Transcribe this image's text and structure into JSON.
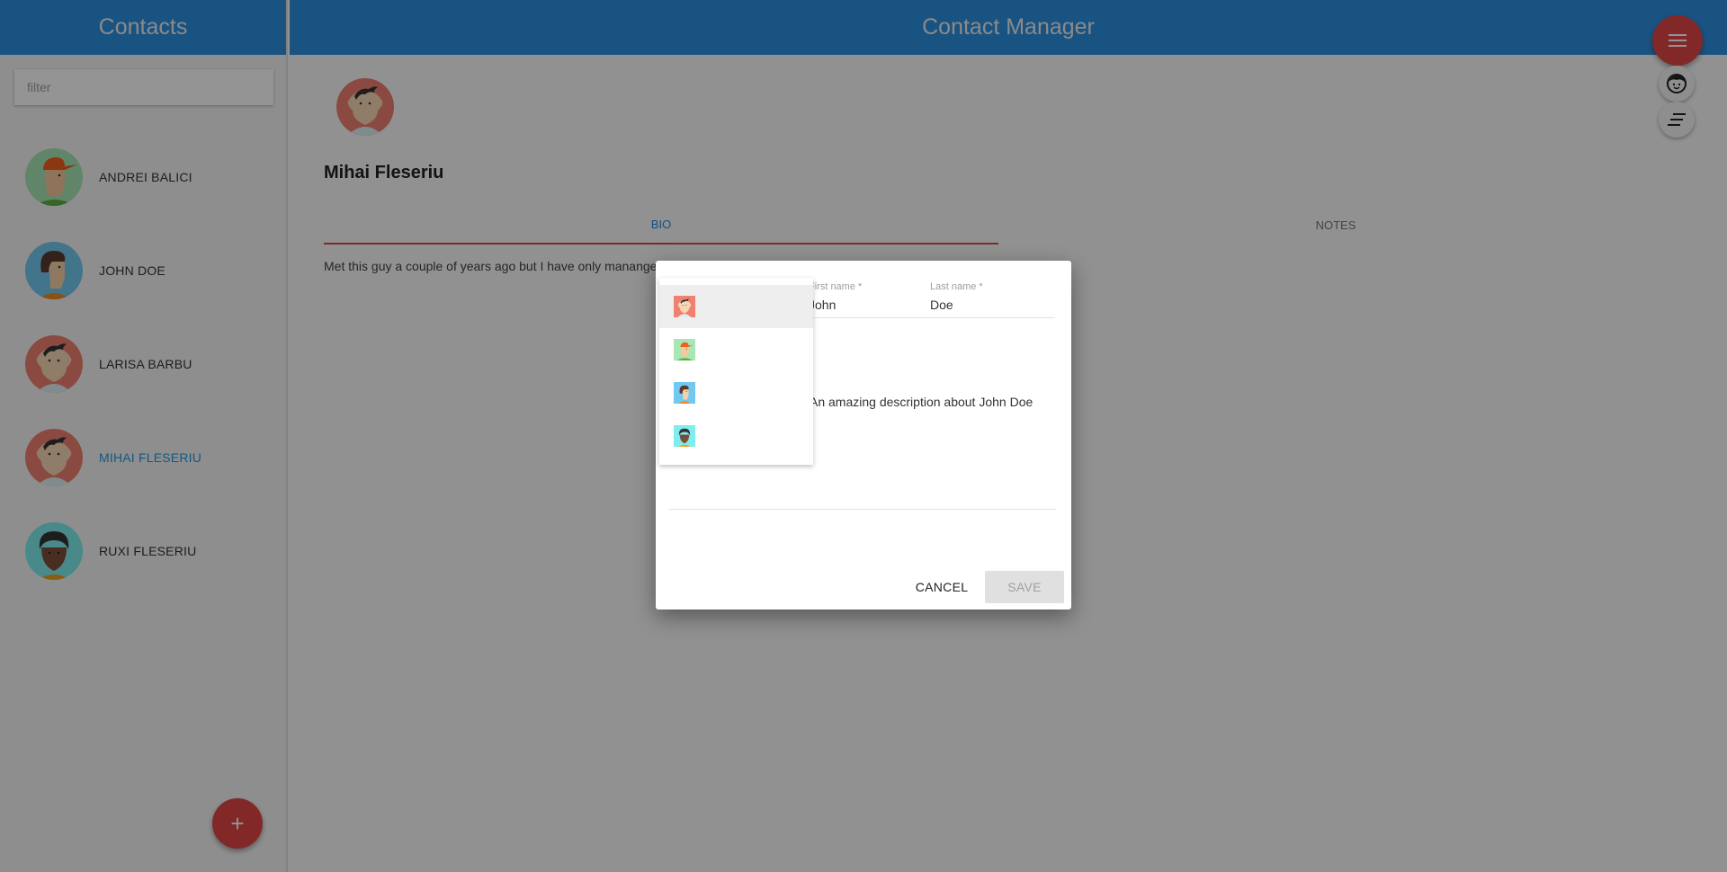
{
  "sidebar": {
    "title": "Contacts",
    "filter_placeholder": "filter",
    "filter_value": "",
    "contacts": [
      {
        "name": "ANDREI BALICI",
        "avatar": "avatar-cap-green",
        "selected": false
      },
      {
        "name": "JOHN DOE",
        "avatar": "avatar-hair-blue",
        "selected": false
      },
      {
        "name": "LARISA BARBU",
        "avatar": "avatar-boy-red",
        "selected": false
      },
      {
        "name": "MIHAI FLESERIU",
        "avatar": "avatar-boy-red",
        "selected": true
      },
      {
        "name": "RUXI FLESERIU",
        "avatar": "avatar-dark-teal",
        "selected": false
      }
    ],
    "add_button_icon": "+"
  },
  "main": {
    "title": "Contact Manager",
    "selected_name": "Mihai Fleseriu",
    "tabs": [
      {
        "label": "BIO",
        "active": true
      },
      {
        "label": "NOTES",
        "active": false
      }
    ],
    "bio_text": "Met this guy a couple of years ago but I have only mananged to make one good friend."
  },
  "speed_dial": {
    "menu_icon": "menu-icon",
    "actions": [
      "face-icon",
      "sort-icon"
    ]
  },
  "dialog": {
    "first_name_label": "First name *",
    "first_name_value": "John",
    "last_name_label": "Last name *",
    "last_name_value": "Doe",
    "description_value": "An amazing description about John Doe",
    "cancel_label": "CANCEL",
    "save_label": "SAVE",
    "avatar_options": [
      "avatar-boy-red",
      "avatar-cap-green",
      "avatar-hair-blue",
      "avatar-dark-teal"
    ],
    "highlighted_option": 0
  },
  "colors": {
    "primary": "#2c8fe0",
    "accent": "#e04646",
    "selected_text": "#1e9ae0"
  }
}
